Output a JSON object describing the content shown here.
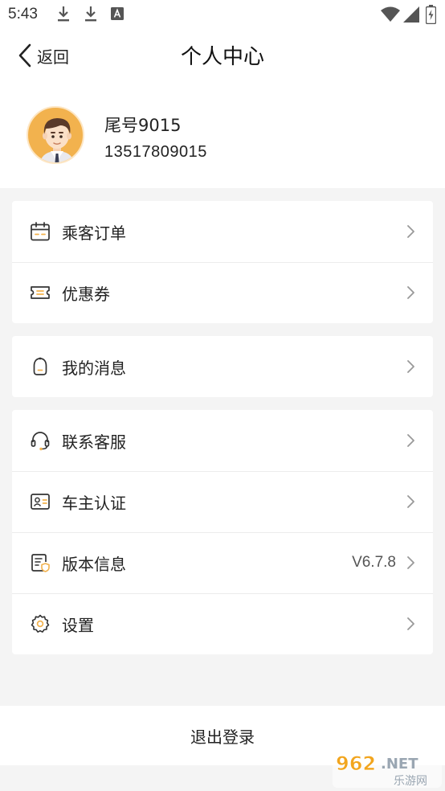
{
  "status_bar": {
    "time": "5:43",
    "left_icons": [
      "download-icon",
      "download-icon",
      "keyboard-a-icon"
    ],
    "right_icons": [
      "wifi-icon",
      "signal-icon",
      "battery-charging-icon"
    ]
  },
  "nav": {
    "back_label": "返回",
    "title": "个人中心"
  },
  "profile": {
    "nickname": "尾号9015",
    "phone": "13517809015",
    "avatar_icon": "male-avatar-icon"
  },
  "groups": [
    {
      "items": [
        {
          "label": "乘客订单",
          "icon": "calendar-icon"
        },
        {
          "label": "优惠券",
          "icon": "coupon-icon"
        }
      ]
    },
    {
      "items": [
        {
          "label": "我的消息",
          "icon": "bell-icon"
        }
      ]
    },
    {
      "items": [
        {
          "label": "联系客服",
          "icon": "headset-icon"
        },
        {
          "label": "车主认证",
          "icon": "id-card-icon"
        },
        {
          "label": "版本信息",
          "icon": "document-shield-icon",
          "value": "V6.7.8"
        },
        {
          "label": "设置",
          "icon": "gear-icon"
        }
      ]
    }
  ],
  "logout_label": "退出登录",
  "watermark": {
    "text": "962.NET",
    "subtext": "乐游网"
  },
  "colors": {
    "accent": "#f2b24e",
    "page_bg": "#f4f4f4",
    "card_bg": "#ffffff",
    "icon_stroke": "#333333",
    "divider": "#ececec"
  }
}
